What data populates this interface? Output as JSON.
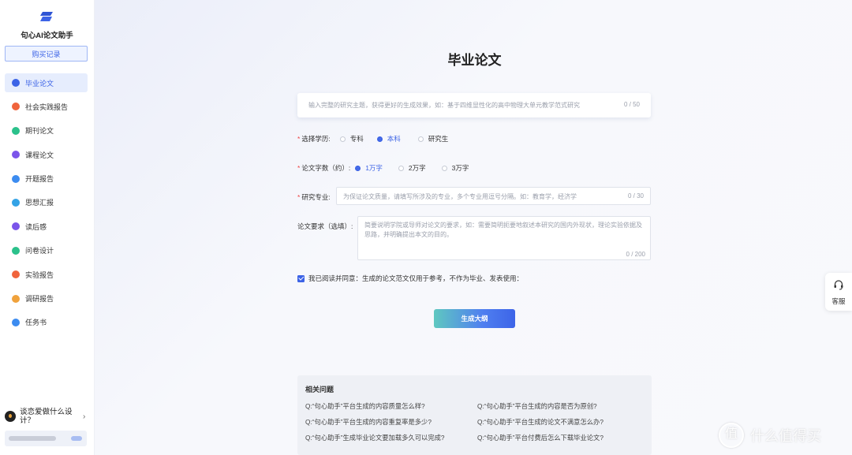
{
  "sidebar": {
    "app_title": "句心AI论文助手",
    "purchase_label": "购买记录",
    "items": [
      {
        "label": "毕业论文",
        "icon": "thesis-icon",
        "color": "#3c63e6",
        "active": true
      },
      {
        "label": "社会实践报告",
        "icon": "social-practice-icon",
        "color": "#f0643c"
      },
      {
        "label": "期刊论文",
        "icon": "journal-icon",
        "color": "#2bc18b"
      },
      {
        "label": "课程论文",
        "icon": "course-icon",
        "color": "#7b55ea"
      },
      {
        "label": "开题报告",
        "icon": "proposal-icon",
        "color": "#3c8cf0"
      },
      {
        "label": "思想汇报",
        "icon": "thought-report-icon",
        "color": "#34a3e6"
      },
      {
        "label": "读后感",
        "icon": "reading-icon",
        "color": "#7b55ea"
      },
      {
        "label": "问卷设计",
        "icon": "questionnaire-icon",
        "color": "#2bc18b"
      },
      {
        "label": "实验报告",
        "icon": "experiment-icon",
        "color": "#f0643c"
      },
      {
        "label": "调研报告",
        "icon": "research-icon",
        "color": "#f0a23c"
      },
      {
        "label": "任务书",
        "icon": "task-book-icon",
        "color": "#3c8cf0"
      }
    ],
    "promo_text": "谈恋爱做什么设计？",
    "promo_arrow": "›"
  },
  "main": {
    "title": "毕业论文",
    "topic": {
      "placeholder": "输入完整的研究主题，获得更好的生成效果，如：基于四维显性化的高中物理大单元教学范式研究",
      "counter": "0 / 50"
    },
    "education": {
      "label": "选择学历:",
      "options": [
        "专科",
        "本科",
        "研究生"
      ],
      "selected": "本科"
    },
    "word_count": {
      "label": "论文字数（约）:",
      "options": [
        "1万字",
        "2万字",
        "3万字"
      ],
      "selected": "1万字"
    },
    "major": {
      "label": "研究专业:",
      "placeholder": "为保证论文质量，请填写所涉及的专业，多个专业用逗号分隔。如：教育学，经济学",
      "counter": "0 / 30"
    },
    "requirements": {
      "label": "论文要求（选填）:",
      "placeholder": "简要说明学院或导师对论文的要求，如：需要简明扼要地叙述本研究的国内外现状，理论实验依据及思路，并明确提出本文的目的。",
      "counter": "0 / 200"
    },
    "agreement": {
      "checked": true,
      "text": "我已阅读并同意：生成的论文范文仅用于参考，不作为毕业、发表使用："
    },
    "generate_label": "生成大纲",
    "faq": {
      "title": "相关问题",
      "questions": [
        "Q:“句心助手”平台生成的内容质量怎么样?",
        "Q:“句心助手”平台生成的内容是否为原创?",
        "Q:“句心助手”平台生成的内容重复率是多少?",
        "Q:“句心助手”平台生成的论文不满意怎么办?",
        "Q:“句心助手”生成毕业论文要加载多久可以完成?",
        "Q:“句心助手”平台付费后怎么下载毕业论文?"
      ]
    }
  },
  "support": {
    "label": "客服",
    "icon": "headset-icon"
  },
  "watermark": {
    "text": "什么值得买",
    "glyph": "值"
  }
}
